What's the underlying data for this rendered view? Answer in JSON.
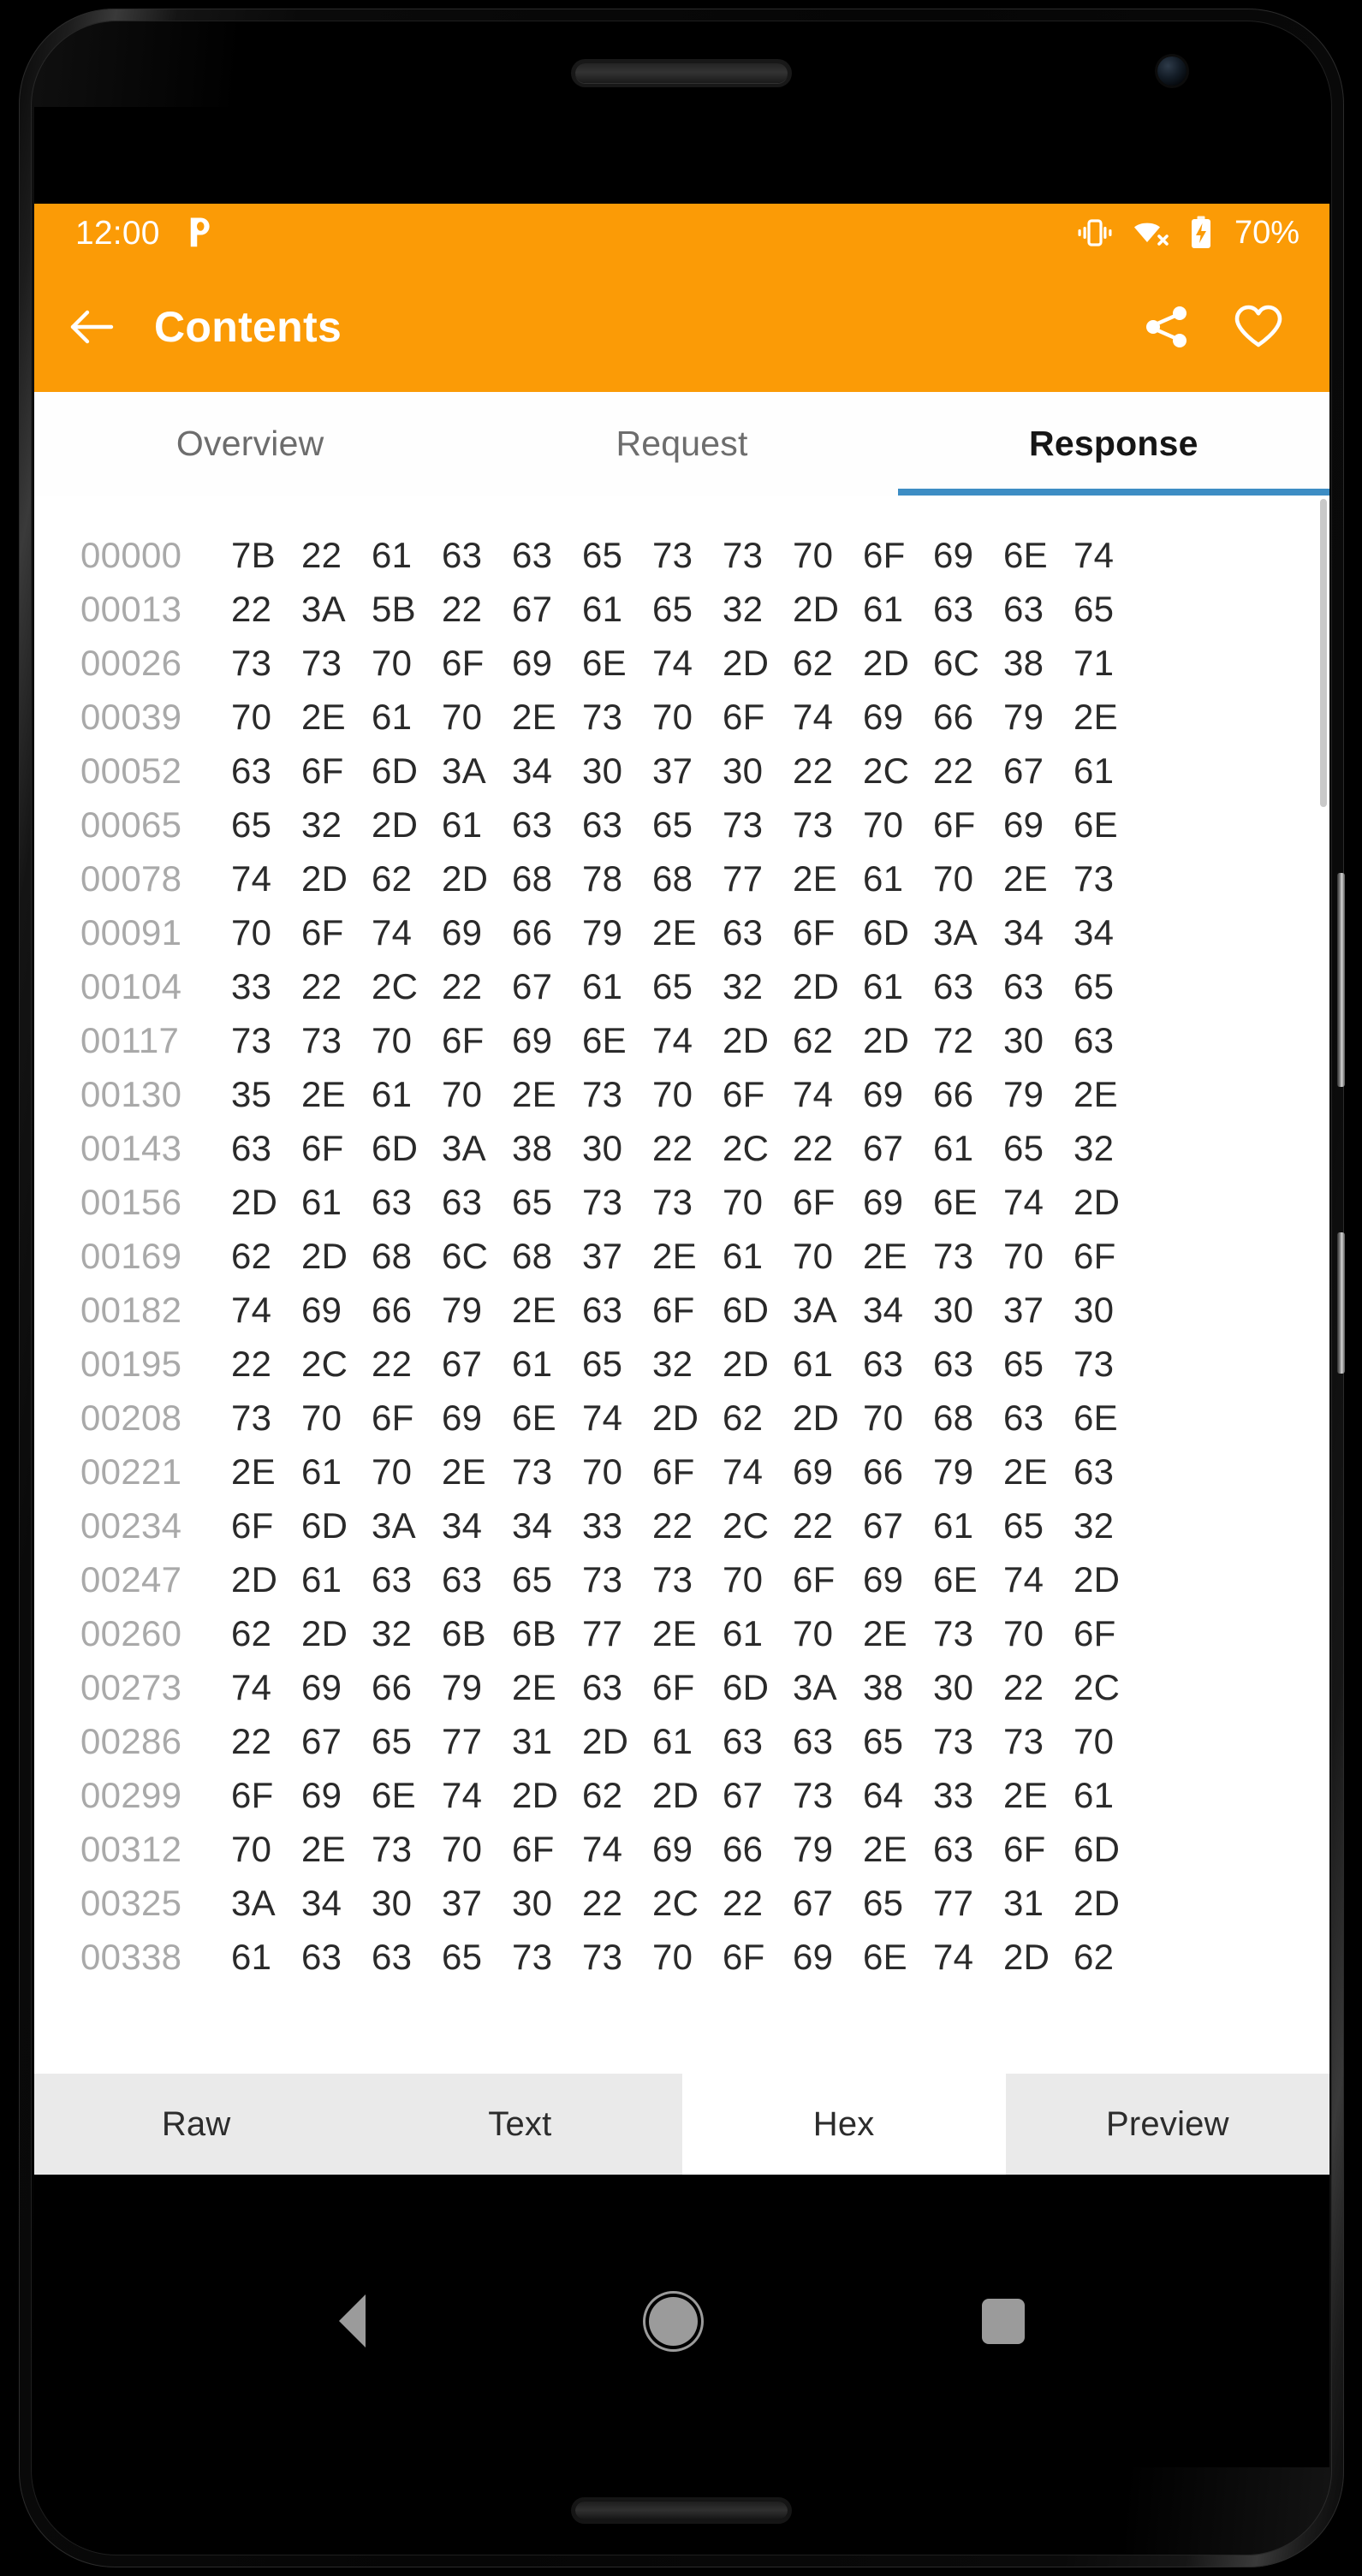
{
  "theme": {
    "accent": "#fb9b06",
    "tab_indicator": "#3d8dc4",
    "offset_color": "#a9a9a9",
    "byte_color": "#2a2a2a"
  },
  "status_bar": {
    "time": "12:00",
    "notification_icon": "pushbullet-icon",
    "icons": [
      "vibrate-icon",
      "wifi-no-internet-icon",
      "battery-charging-icon"
    ],
    "battery": "70%"
  },
  "app_bar": {
    "back_icon": "arrow-left-icon",
    "title": "Contents",
    "share_icon": "share-icon",
    "favorite_icon": "heart-outline-icon"
  },
  "tabs": [
    {
      "label": "Overview",
      "selected": false
    },
    {
      "label": "Request",
      "selected": false
    },
    {
      "label": "Response",
      "selected": true
    }
  ],
  "hex_view": {
    "rows": [
      {
        "offset": "00000",
        "bytes": [
          "7B",
          "22",
          "61",
          "63",
          "63",
          "65",
          "73",
          "73",
          "70",
          "6F",
          "69",
          "6E",
          "74"
        ]
      },
      {
        "offset": "00013",
        "bytes": [
          "22",
          "3A",
          "5B",
          "22",
          "67",
          "61",
          "65",
          "32",
          "2D",
          "61",
          "63",
          "63",
          "65"
        ]
      },
      {
        "offset": "00026",
        "bytes": [
          "73",
          "73",
          "70",
          "6F",
          "69",
          "6E",
          "74",
          "2D",
          "62",
          "2D",
          "6C",
          "38",
          "71"
        ]
      },
      {
        "offset": "00039",
        "bytes": [
          "70",
          "2E",
          "61",
          "70",
          "2E",
          "73",
          "70",
          "6F",
          "74",
          "69",
          "66",
          "79",
          "2E"
        ]
      },
      {
        "offset": "00052",
        "bytes": [
          "63",
          "6F",
          "6D",
          "3A",
          "34",
          "30",
          "37",
          "30",
          "22",
          "2C",
          "22",
          "67",
          "61"
        ]
      },
      {
        "offset": "00065",
        "bytes": [
          "65",
          "32",
          "2D",
          "61",
          "63",
          "63",
          "65",
          "73",
          "73",
          "70",
          "6F",
          "69",
          "6E"
        ]
      },
      {
        "offset": "00078",
        "bytes": [
          "74",
          "2D",
          "62",
          "2D",
          "68",
          "78",
          "68",
          "77",
          "2E",
          "61",
          "70",
          "2E",
          "73"
        ]
      },
      {
        "offset": "00091",
        "bytes": [
          "70",
          "6F",
          "74",
          "69",
          "66",
          "79",
          "2E",
          "63",
          "6F",
          "6D",
          "3A",
          "34",
          "34"
        ]
      },
      {
        "offset": "00104",
        "bytes": [
          "33",
          "22",
          "2C",
          "22",
          "67",
          "61",
          "65",
          "32",
          "2D",
          "61",
          "63",
          "63",
          "65"
        ]
      },
      {
        "offset": "00117",
        "bytes": [
          "73",
          "73",
          "70",
          "6F",
          "69",
          "6E",
          "74",
          "2D",
          "62",
          "2D",
          "72",
          "30",
          "63"
        ]
      },
      {
        "offset": "00130",
        "bytes": [
          "35",
          "2E",
          "61",
          "70",
          "2E",
          "73",
          "70",
          "6F",
          "74",
          "69",
          "66",
          "79",
          "2E"
        ]
      },
      {
        "offset": "00143",
        "bytes": [
          "63",
          "6F",
          "6D",
          "3A",
          "38",
          "30",
          "22",
          "2C",
          "22",
          "67",
          "61",
          "65",
          "32"
        ]
      },
      {
        "offset": "00156",
        "bytes": [
          "2D",
          "61",
          "63",
          "63",
          "65",
          "73",
          "73",
          "70",
          "6F",
          "69",
          "6E",
          "74",
          "2D"
        ]
      },
      {
        "offset": "00169",
        "bytes": [
          "62",
          "2D",
          "68",
          "6C",
          "68",
          "37",
          "2E",
          "61",
          "70",
          "2E",
          "73",
          "70",
          "6F"
        ]
      },
      {
        "offset": "00182",
        "bytes": [
          "74",
          "69",
          "66",
          "79",
          "2E",
          "63",
          "6F",
          "6D",
          "3A",
          "34",
          "30",
          "37",
          "30"
        ]
      },
      {
        "offset": "00195",
        "bytes": [
          "22",
          "2C",
          "22",
          "67",
          "61",
          "65",
          "32",
          "2D",
          "61",
          "63",
          "63",
          "65",
          "73"
        ]
      },
      {
        "offset": "00208",
        "bytes": [
          "73",
          "70",
          "6F",
          "69",
          "6E",
          "74",
          "2D",
          "62",
          "2D",
          "70",
          "68",
          "63",
          "6E"
        ]
      },
      {
        "offset": "00221",
        "bytes": [
          "2E",
          "61",
          "70",
          "2E",
          "73",
          "70",
          "6F",
          "74",
          "69",
          "66",
          "79",
          "2E",
          "63"
        ]
      },
      {
        "offset": "00234",
        "bytes": [
          "6F",
          "6D",
          "3A",
          "34",
          "34",
          "33",
          "22",
          "2C",
          "22",
          "67",
          "61",
          "65",
          "32"
        ]
      },
      {
        "offset": "00247",
        "bytes": [
          "2D",
          "61",
          "63",
          "63",
          "65",
          "73",
          "73",
          "70",
          "6F",
          "69",
          "6E",
          "74",
          "2D"
        ]
      },
      {
        "offset": "00260",
        "bytes": [
          "62",
          "2D",
          "32",
          "6B",
          "6B",
          "77",
          "2E",
          "61",
          "70",
          "2E",
          "73",
          "70",
          "6F"
        ]
      },
      {
        "offset": "00273",
        "bytes": [
          "74",
          "69",
          "66",
          "79",
          "2E",
          "63",
          "6F",
          "6D",
          "3A",
          "38",
          "30",
          "22",
          "2C"
        ]
      },
      {
        "offset": "00286",
        "bytes": [
          "22",
          "67",
          "65",
          "77",
          "31",
          "2D",
          "61",
          "63",
          "63",
          "65",
          "73",
          "73",
          "70"
        ]
      },
      {
        "offset": "00299",
        "bytes": [
          "6F",
          "69",
          "6E",
          "74",
          "2D",
          "62",
          "2D",
          "67",
          "73",
          "64",
          "33",
          "2E",
          "61"
        ]
      },
      {
        "offset": "00312",
        "bytes": [
          "70",
          "2E",
          "73",
          "70",
          "6F",
          "74",
          "69",
          "66",
          "79",
          "2E",
          "63",
          "6F",
          "6D"
        ]
      },
      {
        "offset": "00325",
        "bytes": [
          "3A",
          "34",
          "30",
          "37",
          "30",
          "22",
          "2C",
          "22",
          "67",
          "65",
          "77",
          "31",
          "2D"
        ]
      },
      {
        "offset": "00338",
        "bytes": [
          "61",
          "63",
          "63",
          "65",
          "73",
          "73",
          "70",
          "6F",
          "69",
          "6E",
          "74",
          "2D",
          "62"
        ]
      }
    ]
  },
  "format_tabs": [
    {
      "label": "Raw",
      "selected": false
    },
    {
      "label": "Text",
      "selected": false
    },
    {
      "label": "Hex",
      "selected": true
    },
    {
      "label": "Preview",
      "selected": false
    }
  ],
  "nav_bar": {
    "back_icon": "triangle-back-icon",
    "home_icon": "circle-home-icon",
    "recents_icon": "square-recents-icon"
  }
}
